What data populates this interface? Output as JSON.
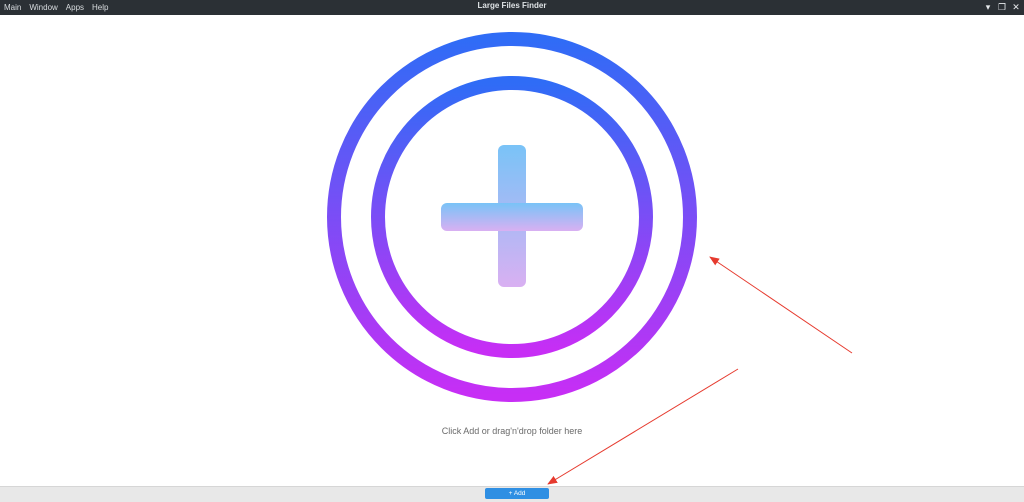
{
  "menu": {
    "items": [
      "Main",
      "Window",
      "Apps",
      "Help"
    ]
  },
  "window": {
    "title": "Large Files Finder",
    "controls": {
      "minimize": "▾",
      "restore": "❐",
      "close": "✕"
    }
  },
  "main": {
    "hint": "Click Add or drag'n'drop folder here",
    "icon": "add-circle-icon",
    "gradient": {
      "ring_top": "#2f6cf6",
      "ring_bottom": "#c72ef5",
      "plus_top": "#79c3f7",
      "plus_bottom": "#d9b0f2"
    }
  },
  "bottom_bar": {
    "add_label": "+ Add",
    "button_color": "#2f8fe3"
  },
  "annotations": {
    "arrow_color": "#e63a2e"
  }
}
